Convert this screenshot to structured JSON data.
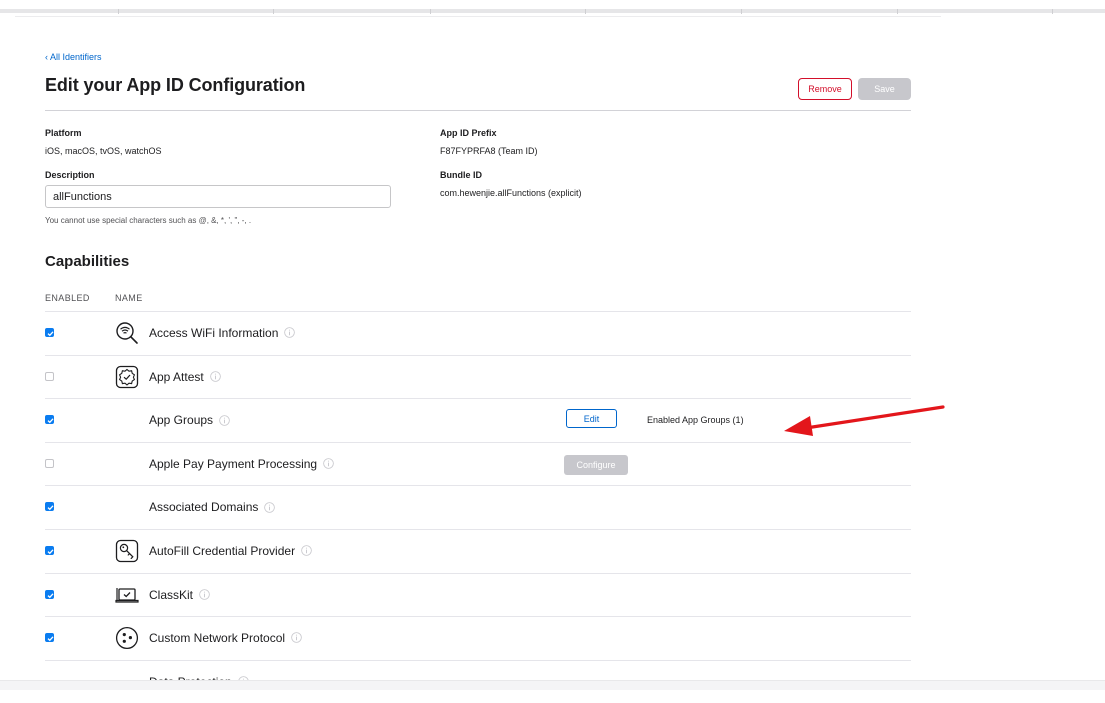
{
  "header": {
    "back_link": "‹ All Identifiers",
    "title": "Edit your App ID Configuration",
    "remove_label": "Remove",
    "save_label": "Save"
  },
  "fields": {
    "platform_label": "Platform",
    "platform_value": "iOS, macOS, tvOS, watchOS",
    "prefix_label": "App ID Prefix",
    "prefix_value": "F87FYPRFA8 (Team ID)",
    "description_label": "Description",
    "description_value": "allFunctions",
    "description_hint": "You cannot use special characters such as @, &, *, ', \", -, .",
    "bundle_label": "Bundle ID",
    "bundle_value": "com.hewenjie.allFunctions (explicit)"
  },
  "capabilities": {
    "title": "Capabilities",
    "col_enabled": "ENABLED",
    "col_name": "NAME",
    "items": [
      {
        "name": "Access WiFi Information",
        "enabled": true,
        "icon": "wifi-search-icon"
      },
      {
        "name": "App Attest",
        "enabled": false,
        "icon": "app-attest-icon"
      },
      {
        "name": "App Groups",
        "enabled": true,
        "icon": "",
        "edit_label": "Edit",
        "status": "Enabled App Groups (1)"
      },
      {
        "name": "Apple Pay Payment Processing",
        "enabled": false,
        "icon": "",
        "configure_label": "Configure"
      },
      {
        "name": "Associated Domains",
        "enabled": true,
        "icon": ""
      },
      {
        "name": "AutoFill Credential Provider",
        "enabled": true,
        "icon": "key-icon"
      },
      {
        "name": "ClassKit",
        "enabled": true,
        "icon": "classkit-icon"
      },
      {
        "name": "Custom Network Protocol",
        "enabled": true,
        "icon": "network-protocol-icon"
      },
      {
        "name": "Data Protection",
        "enabled": null,
        "icon": ""
      }
    ]
  },
  "colors": {
    "accent": "#0066cc",
    "checkbox": "#0a7cf0",
    "destructive": "#d30f2a",
    "disabled": "#c7c7cc",
    "arrow": "#e3161b"
  }
}
